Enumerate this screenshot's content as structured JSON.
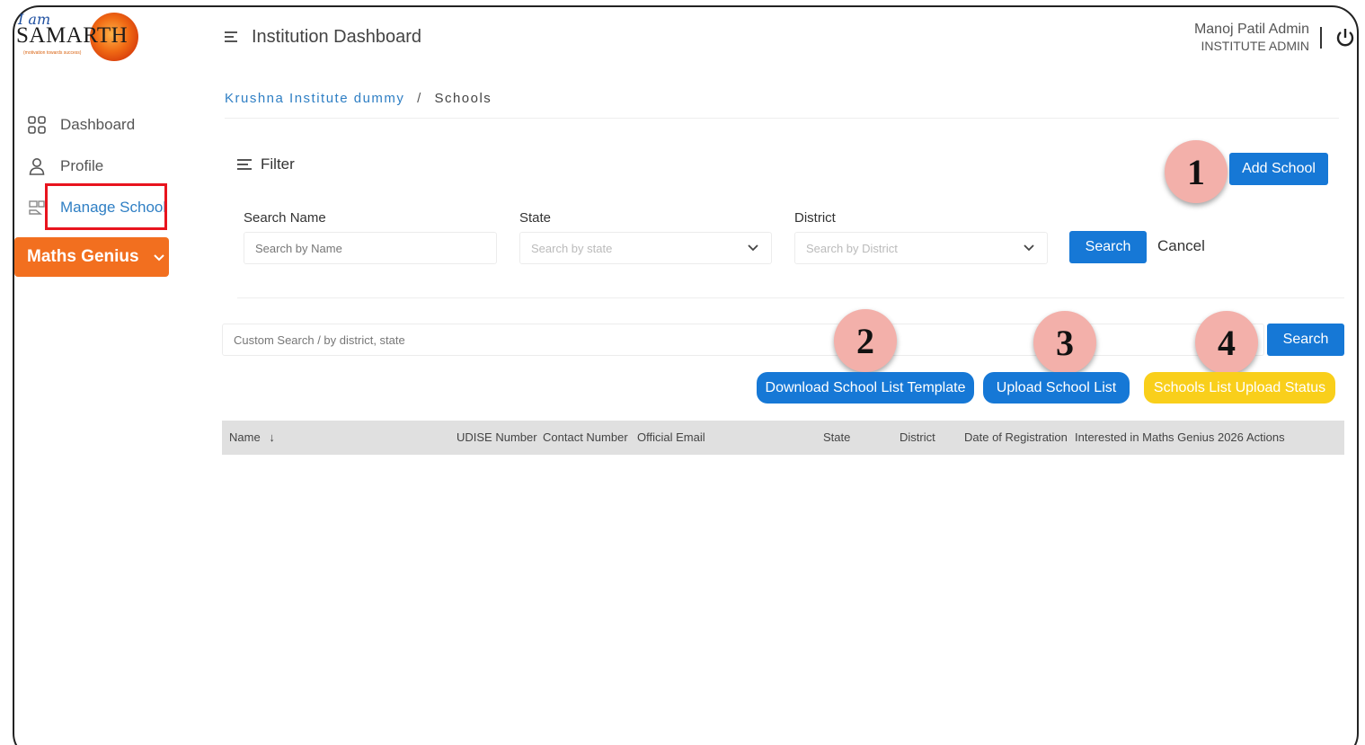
{
  "logo": {
    "iam": "I am",
    "brand": "SAMARTH",
    "tagline": "(motivation towards success)"
  },
  "sidebar": {
    "items": [
      {
        "label": "Dashboard",
        "icon": "dashboard-grid-icon"
      },
      {
        "label": "Profile",
        "icon": "user-icon"
      },
      {
        "label": "Manage School",
        "icon": "school-icon"
      }
    ],
    "maths_genius": {
      "label": "Maths Genius",
      "icon": "chevron-down-icon",
      "color": "#f26f1f"
    }
  },
  "header": {
    "title": "Institution Dashboard",
    "user_name": "Manoj Patil Admin",
    "user_role": "INSTITUTE ADMIN"
  },
  "breadcrumb": {
    "link": "Krushna Institute dummy",
    "separator": "/",
    "current": "Schools"
  },
  "filter": {
    "label": "Filter",
    "search_name_label": "Search Name",
    "search_name_placeholder": "Search by Name",
    "state_label": "State",
    "state_placeholder": "Search by state",
    "district_label": "District",
    "district_placeholder": "Search by District",
    "search_button": "Search",
    "cancel_button": "Cancel"
  },
  "add_school_button": "Add School",
  "custom_search": {
    "placeholder": "Custom Search / by district, state",
    "button": "Search"
  },
  "actions": {
    "download_template": "Download School List Template",
    "upload_list": "Upload School List",
    "upload_status": "Schools List Upload Status"
  },
  "badges": [
    "1",
    "2",
    "3",
    "4"
  ],
  "table": {
    "columns": [
      "Name",
      "UDISE Number",
      "Contact Number",
      "Official Email",
      "State",
      "District",
      "Date of Registration",
      "Interested in Maths Genius 2026",
      "Actions"
    ],
    "sort_indicator": "↓"
  },
  "colors": {
    "primary": "#1678d6",
    "accent": "#f26f1f",
    "warning": "#f9cf1b",
    "highlight": "#e8141e",
    "badge": "#f3b0aa"
  }
}
